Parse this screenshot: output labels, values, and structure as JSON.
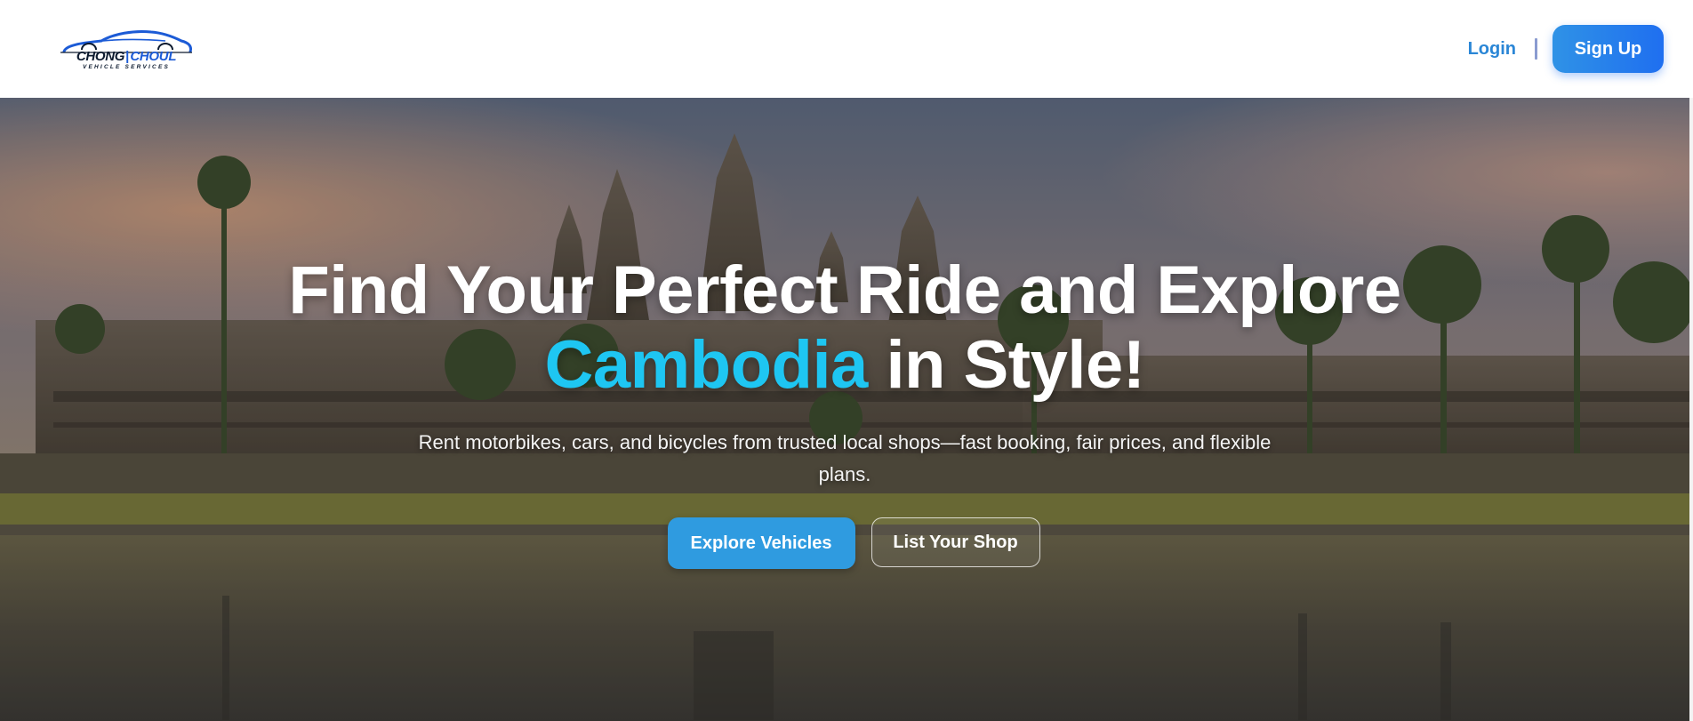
{
  "brand": {
    "name_part1": "CHONG",
    "separator": "|",
    "name_part2": "CHOUL",
    "tagline": "VEHICLE SERVICES",
    "primary_color": "#1c5bd6",
    "dark_color": "#0d1b2f",
    "logo_icon": "car-outline-icon"
  },
  "nav": {
    "login_label": "Login",
    "signup_label": "Sign Up"
  },
  "hero": {
    "title_line1": "Find Your Perfect Ride and Explore",
    "title_accent": "Cambodia",
    "title_line2_rest": " in Style!",
    "accent_color": "#1ec6f2",
    "subtitle": "Rent motorbikes, cars, and bicycles from trusted local shops—fast booking, fair prices, and flexible plans.",
    "primary_cta": "Explore Vehicles",
    "secondary_cta": "List Your Shop",
    "background": "angkor-wat-temple-photo"
  }
}
